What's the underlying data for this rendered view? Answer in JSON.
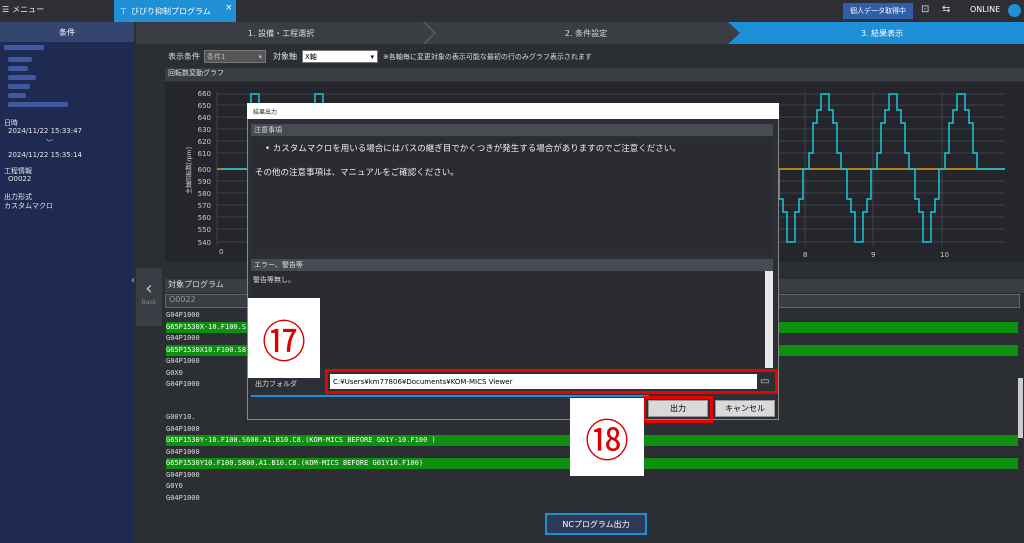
{
  "topbar": {
    "menu_label": "メニュー",
    "tab_label": "びびり抑制プログラム",
    "tab_close": "×",
    "badge": "個人データ取得中",
    "online": "ONLINE"
  },
  "sidebar": {
    "header": "条件",
    "date_label": "日時",
    "date_start": "2024/11/22 15:33:47",
    "date_sep": "﹀",
    "date_end": "2024/11/22 15:35:14",
    "process_label": "工程情報",
    "process_value": "O0022",
    "output_label": "出力形式",
    "output_value": "カスタムマクロ"
  },
  "steps": {
    "s1": "1. 設備・工程選択",
    "s2": "2. 条件設定",
    "s3": "3. 結果表示"
  },
  "conditions": {
    "display_label": "表示条件",
    "display_value": "条件1",
    "axis_label": "対象軸",
    "axis_value": "X軸",
    "note": "※各軸毎に変更対象の表示可能な最初の行のみグラフ表示されます"
  },
  "graph": {
    "title": "回転数変動グラフ",
    "ylabel": "主軸回転数[rpm]",
    "yticks": [
      "660",
      "650",
      "640",
      "630",
      "620",
      "610",
      "600",
      "590",
      "580",
      "570",
      "560",
      "550",
      "540"
    ],
    "xticks_left": [
      "0"
    ],
    "xticks_right": [
      "8",
      "9",
      "10"
    ]
  },
  "back": {
    "label": "Back",
    "arrow": "‹"
  },
  "program": {
    "header": "対象プログラム",
    "selected": "O0022",
    "lines_top": [
      {
        "text": "G04P1000",
        "hl": false
      },
      {
        "text": "G65P1530X-10.F100.S",
        "hl": true
      },
      {
        "text": "G04P1000",
        "hl": false
      },
      {
        "text": "G65P1530X10.F100.S8",
        "hl": true
      },
      {
        "text": "G04P1000",
        "hl": false
      },
      {
        "text": "G0X0",
        "hl": false
      },
      {
        "text": "G04P1000",
        "hl": false
      }
    ],
    "lines_bottom": [
      {
        "text": "G00Y10.",
        "hl": false
      },
      {
        "text": "G04P1000",
        "hl": false
      },
      {
        "text": "G65P1530Y-10.F100.S600.A1.B10.C8.(KOM-MICS BEFORE G01Y-10.F100 )",
        "hl": true
      },
      {
        "text": "G04P1000",
        "hl": false
      },
      {
        "text": "G65P1530Y10.F100.S800.A1.B10.C8.(KOM-MICS BEFORE G01Y10.F100)",
        "hl": true
      },
      {
        "text": "G04P1000",
        "hl": false
      },
      {
        "text": "G0Y0",
        "hl": false
      },
      {
        "text": "G04P1000",
        "hl": false
      }
    ],
    "nc_button": "NCプログラム出力"
  },
  "dialog": {
    "title": "結果出力",
    "notes_header": "注意事項",
    "note1": "カスタムマクロを用いる場合にはパスの継ぎ目でかくつきが発生する場合がありますのでご注意ください。",
    "note2": "その他の注意事項は、マニュアルをご確認ください。",
    "error_header": "エラー、警告等",
    "error_text": "警告等無し。",
    "folder_label": "出力フォルダ",
    "folder_value": "C:¥Users¥km77806¥Documents¥KOM-MICS Viewer",
    "output_button": "出力",
    "cancel_button": "キャンセル"
  },
  "callouts": {
    "c17": "⑰",
    "c18": "⑱"
  },
  "colors": {
    "accent": "#1f8fd6",
    "highlight": "#0f8f0f",
    "callout": "#e00000",
    "series_cyan": "#19c9d6",
    "series_orange": "#e69a1a"
  }
}
